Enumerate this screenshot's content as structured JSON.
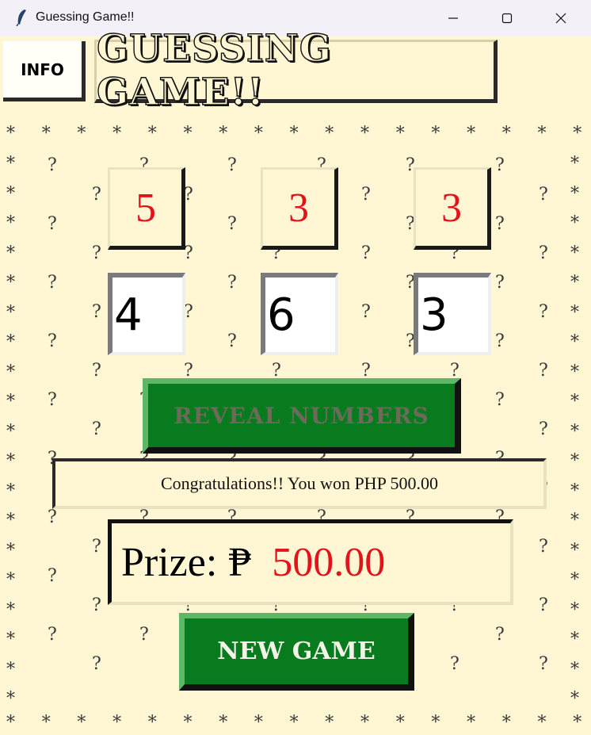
{
  "window": {
    "title": "Guessing Game!!",
    "controls": [
      "minimize",
      "maximize",
      "close"
    ]
  },
  "header": {
    "info_label": "INFO",
    "title": "GUESSING GAME!!"
  },
  "revealed_numbers": [
    "5",
    "3",
    "3"
  ],
  "guesses": [
    "4",
    "6",
    "3"
  ],
  "reveal_button": "REVEAL NUMBERS",
  "message": "Congratulations!! You won PHP 500.00",
  "prize": {
    "label": "Prize:",
    "currency": "₱",
    "amount": "500.00"
  },
  "new_game_button": "NEW GAME",
  "colors": {
    "background": "#fff6d3",
    "accent_red": "#e3121b",
    "button_green": "#087b1e"
  }
}
